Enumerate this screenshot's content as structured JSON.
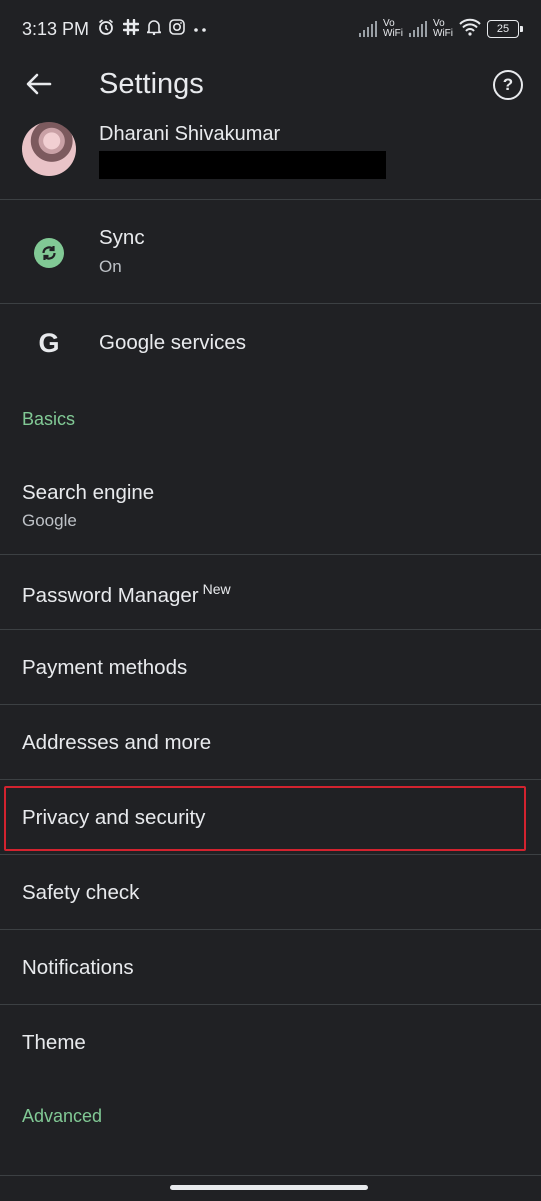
{
  "status_bar": {
    "time": "3:13 PM",
    "icons_left": [
      "alarm-icon",
      "slack-icon",
      "bell-icon",
      "instagram-icon",
      "more-dots-icon"
    ],
    "vowifi_label_1": "Vo",
    "vowifi_label_2": "WiFi",
    "battery": "25"
  },
  "header": {
    "title": "Settings",
    "back_icon": "arrow-left-icon",
    "help_icon": "help-circle-icon",
    "help_glyph": "?"
  },
  "account": {
    "name": "Dharani Shivakumar",
    "email": ""
  },
  "sync": {
    "title": "Sync",
    "status": "On",
    "icon_color": "#81c995"
  },
  "google_services": {
    "icon_glyph": "G",
    "title": "Google services"
  },
  "sections": {
    "basics": "Basics",
    "advanced": "Advanced"
  },
  "items": {
    "search_engine": {
      "title": "Search engine",
      "value": "Google"
    },
    "password_manager": {
      "title": "Password Manager",
      "badge": "New"
    },
    "payment_methods": {
      "title": "Payment methods"
    },
    "addresses": {
      "title": "Addresses and more"
    },
    "privacy": {
      "title": "Privacy and security",
      "highlighted": true
    },
    "safety_check": {
      "title": "Safety check"
    },
    "notifications": {
      "title": "Notifications"
    },
    "theme": {
      "title": "Theme"
    }
  },
  "colors": {
    "background": "#202124",
    "accent_green": "#81c995",
    "highlight_red": "#d3232f",
    "divider": "#3c4043"
  }
}
